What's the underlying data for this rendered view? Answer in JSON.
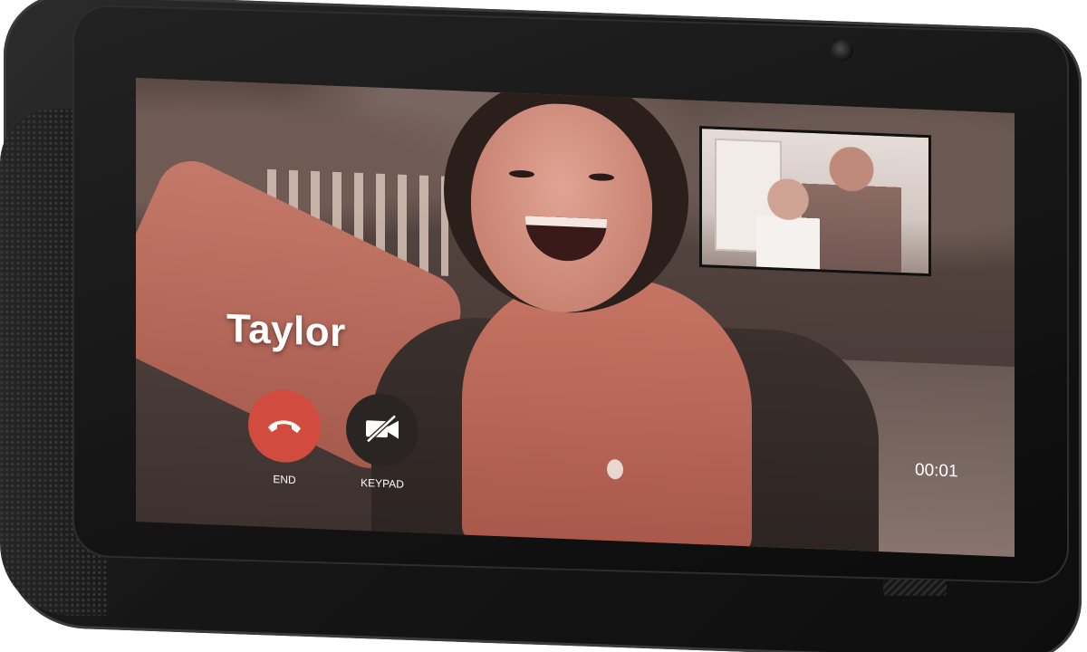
{
  "call": {
    "caller_name": "Taylor",
    "elapsed": "00:01",
    "end_label": "END",
    "keypad_label": "KEYPAD"
  },
  "icons": {
    "end": "phone-hangup-icon",
    "keypad": "video-off-icon"
  },
  "colors": {
    "end_button": "#d24b3f",
    "keypad_button": "#2a2523",
    "overlay_text": "#ffffff"
  }
}
